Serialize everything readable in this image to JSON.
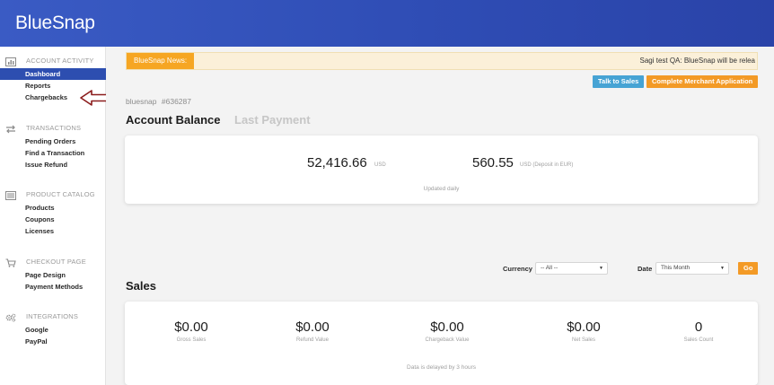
{
  "brand": {
    "logo_text": "BlueSnap"
  },
  "sidebar": {
    "sections": [
      {
        "icon": "bar-chart-icon",
        "title": "ACCOUNT ACTIVITY",
        "items": [
          "Dashboard",
          "Reports",
          "Chargebacks"
        ]
      },
      {
        "icon": "transfer-arrows-icon",
        "title": "TRANSACTIONS",
        "items": [
          "Pending Orders",
          "Find a Transaction",
          "Issue Refund"
        ]
      },
      {
        "icon": "list-icon",
        "title": "PRODUCT CATALOG",
        "items": [
          "Products",
          "Coupons",
          "Licenses"
        ]
      },
      {
        "icon": "cart-icon",
        "title": "CHECKOUT PAGE",
        "items": [
          "Page Design",
          "Payment Methods"
        ]
      },
      {
        "icon": "gears-icon",
        "title": "INTEGRATIONS",
        "items": [
          "Google",
          "PayPal"
        ]
      }
    ],
    "active_item": "Dashboard"
  },
  "news": {
    "label": "BlueSnap News:",
    "text": "Sagi test QA: BlueSnap will be relea"
  },
  "actions": {
    "talk_to_sales": "Talk to Sales",
    "complete_application": "Complete Merchant Application"
  },
  "merchant": {
    "name": "bluesnap",
    "id": "#636287"
  },
  "tabs": {
    "active": "Account Balance",
    "inactive": "Last Payment"
  },
  "balance": {
    "amount_usd": "52,416.66",
    "currency_usd": "USD",
    "amount_deposit": "560.55",
    "currency_deposit": "USD (Deposit in EUR)",
    "note": "Updated daily"
  },
  "filters": {
    "currency_label": "Currency",
    "currency_value": "-- All --",
    "date_label": "Date",
    "date_value": "This Month",
    "go_label": "Go"
  },
  "sales": {
    "title": "Sales",
    "stats": [
      {
        "value": "$0.00",
        "label": "Gross Sales"
      },
      {
        "value": "$0.00",
        "label": "Refund Value"
      },
      {
        "value": "$0.00",
        "label": "Chargeback Value"
      },
      {
        "value": "$0.00",
        "label": "Net Sales"
      },
      {
        "value": "0",
        "label": "Sales Count"
      }
    ],
    "note": "Data is delayed by 3 hours"
  },
  "colors": {
    "header": "#2f4db5",
    "active_nav": "#2d4eb0",
    "accent_orange": "#f39a26",
    "accent_blue": "#46a3d4",
    "annotation_arrow": "#8b1c1c"
  }
}
